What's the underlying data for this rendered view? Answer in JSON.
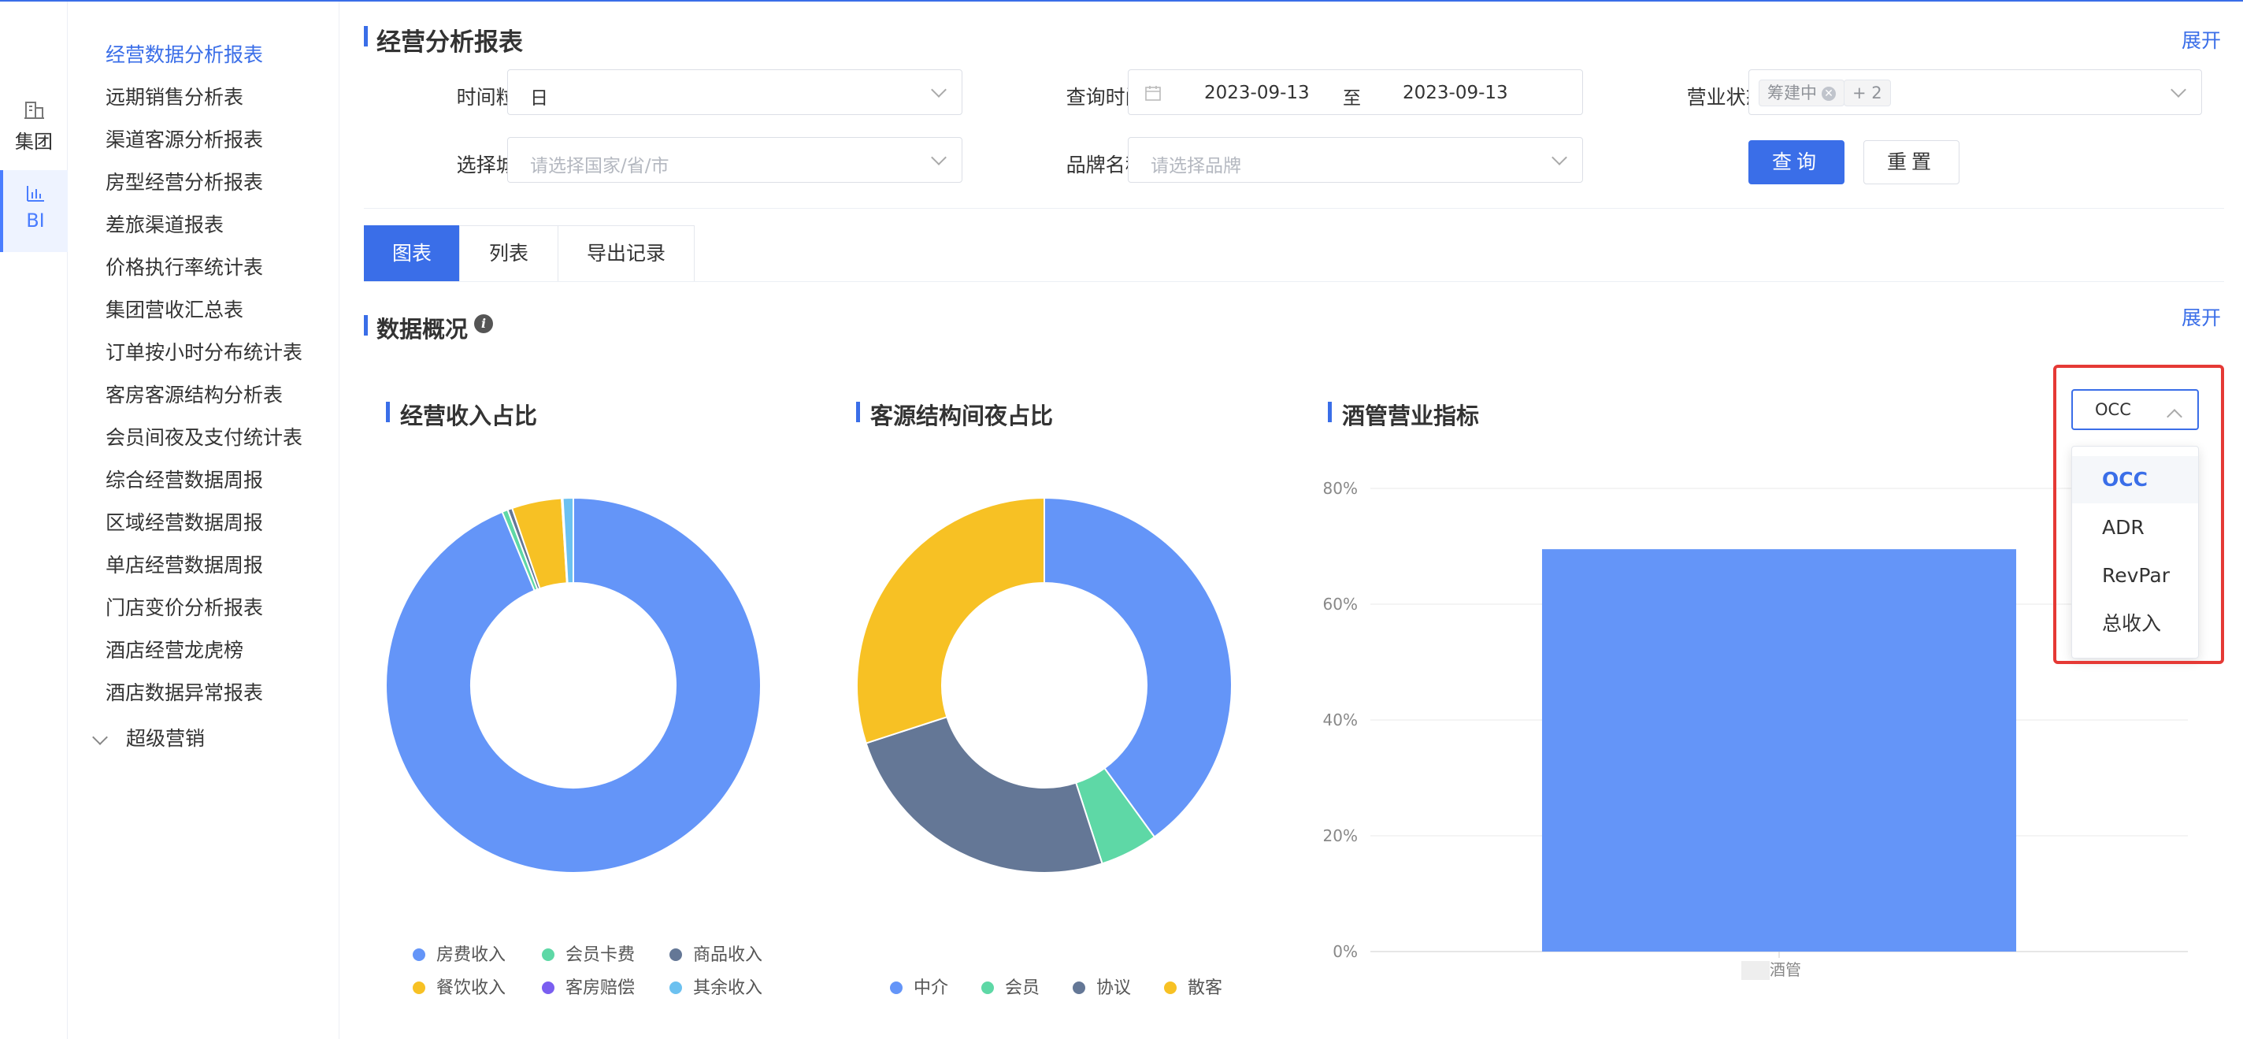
{
  "iconbar": {
    "items": [
      {
        "label": "集团",
        "icon": "building-icon"
      },
      {
        "label": "BI",
        "icon": "bar-chart-icon"
      }
    ]
  },
  "menu": {
    "items": [
      "经营数据分析报表",
      "远期销售分析表",
      "渠道客源分析报表",
      "房型经营分析报表",
      "差旅渠道报表",
      "价格执行率统计表",
      "集团营收汇总表",
      "订单按小时分布统计表",
      "客房客源结构分析表",
      "会员间夜及支付统计表",
      "综合经营数据周报",
      "区域经营数据周报",
      "单店经营数据周报",
      "门店变价分析报表",
      "酒店经营龙虎榜",
      "酒店数据异常报表"
    ],
    "group": "超级营销"
  },
  "header": {
    "title": "经营分析报表",
    "expand": "展开"
  },
  "filters": {
    "granularity": {
      "label": "时间粒度:",
      "value": "日"
    },
    "query_time": {
      "label": "查询时间:",
      "start": "2023-09-13",
      "sep": "至",
      "end": "2023-09-13"
    },
    "status": {
      "label": "营业状态:",
      "tag": "筹建中",
      "more": "+ 2"
    },
    "city": {
      "label": "选择城市:",
      "placeholder": "请选择国家/省/市"
    },
    "brand": {
      "label": "品牌名称:",
      "placeholder": "请选择品牌"
    },
    "query_button": "查询",
    "reset_button": "重置"
  },
  "tabs": [
    "图表",
    "列表",
    "导出记录"
  ],
  "overview": {
    "title": "数据概况",
    "expand": "展开"
  },
  "colors": {
    "blue": "#6495f8",
    "green": "#5ed8a6",
    "slate": "#647796",
    "yellow": "#f7c124",
    "purple": "#7a5ef0",
    "sky": "#6cc1f0"
  },
  "charts": {
    "revenue": {
      "title": "经营收入占比"
    },
    "source": {
      "title": "客源结构间夜占比"
    },
    "indicator": {
      "title": "酒管营业指标"
    }
  },
  "chart_data": [
    {
      "type": "pie",
      "title": "经营收入占比",
      "donut": true,
      "labels": [
        "房费收入",
        "会员卡费",
        "商品收入",
        "餐饮收入",
        "客房赔偿",
        "其余收入"
      ],
      "values": [
        93.8,
        0.5,
        0.4,
        4.3,
        0.1,
        0.9
      ],
      "colors": [
        "#6495f8",
        "#5ed8a6",
        "#647796",
        "#f7c124",
        "#7a5ef0",
        "#6cc1f0"
      ],
      "legend": "bottom"
    },
    {
      "type": "pie",
      "title": "客源结构间夜占比",
      "donut": true,
      "labels": [
        "中介",
        "会员",
        "协议",
        "散客"
      ],
      "values": [
        40,
        5,
        25,
        30
      ],
      "colors": [
        "#6495f8",
        "#5ed8a6",
        "#647796",
        "#f7c124"
      ],
      "legend": "bottom"
    },
    {
      "type": "bar",
      "title": "酒管营业指标",
      "categories": [
        "酒管"
      ],
      "values": [
        69.5
      ],
      "ylim": [
        0,
        80
      ],
      "yticks": [
        "0%",
        "20%",
        "40%",
        "60%",
        "80%"
      ],
      "grid": true,
      "color": "#6495f8"
    }
  ],
  "dropdown": {
    "selected": "OCC",
    "options": [
      "OCC",
      "ADR",
      "RevPar",
      "总收入"
    ]
  }
}
